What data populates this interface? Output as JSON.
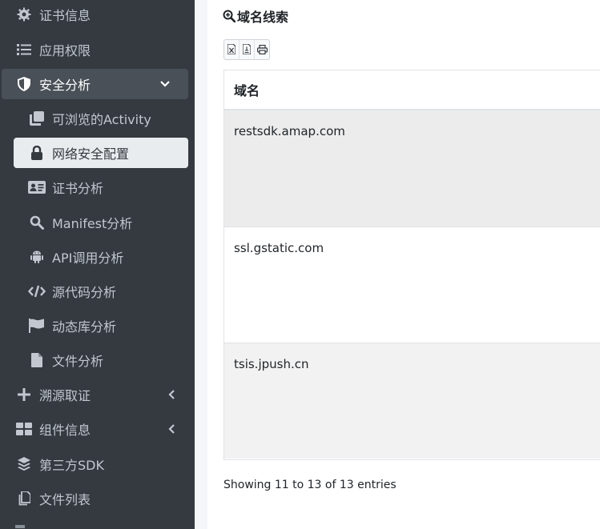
{
  "sidebar": {
    "items": [
      {
        "label": "证书信息",
        "icon": "gear-icon"
      },
      {
        "label": "应用权限",
        "icon": "list-icon"
      },
      {
        "label": "安全分析",
        "icon": "shield-icon"
      },
      {
        "label": "可浏览的Activity",
        "icon": "clone-icon"
      },
      {
        "label": "网络安全配置",
        "icon": "lock-icon"
      },
      {
        "label": "证书分析",
        "icon": "id-card-icon"
      },
      {
        "label": "Manifest分析",
        "icon": "search-icon"
      },
      {
        "label": "API调用分析",
        "icon": "android-icon"
      },
      {
        "label": "源代码分析",
        "icon": "code-icon"
      },
      {
        "label": "动态库分析",
        "icon": "flag-icon"
      },
      {
        "label": "文件分析",
        "icon": "file-icon"
      },
      {
        "label": "溯源取证",
        "icon": "plus-icon"
      },
      {
        "label": "组件信息",
        "icon": "th-large-icon"
      },
      {
        "label": "第三方SDK",
        "icon": "layers-icon"
      },
      {
        "label": "文件列表",
        "icon": "copy-icon"
      }
    ]
  },
  "main": {
    "title": "域名线索",
    "export_buttons": [
      "excel-icon",
      "pdf-icon",
      "print-icon"
    ],
    "table": {
      "header": "域名",
      "rows": [
        "restsdk.amap.com",
        "ssl.gstatic.com",
        "tsis.jpush.cn"
      ]
    },
    "info": "Showing 11 to 13 of 13 entries"
  },
  "colors": {
    "sidebar_bg": "#343a40",
    "sidebar_text": "#c2c7d0",
    "active_bg": "#e9ecef",
    "open_bg": "#495057",
    "row_striped": "#f2f2f2",
    "row_hover": "#ececec"
  }
}
